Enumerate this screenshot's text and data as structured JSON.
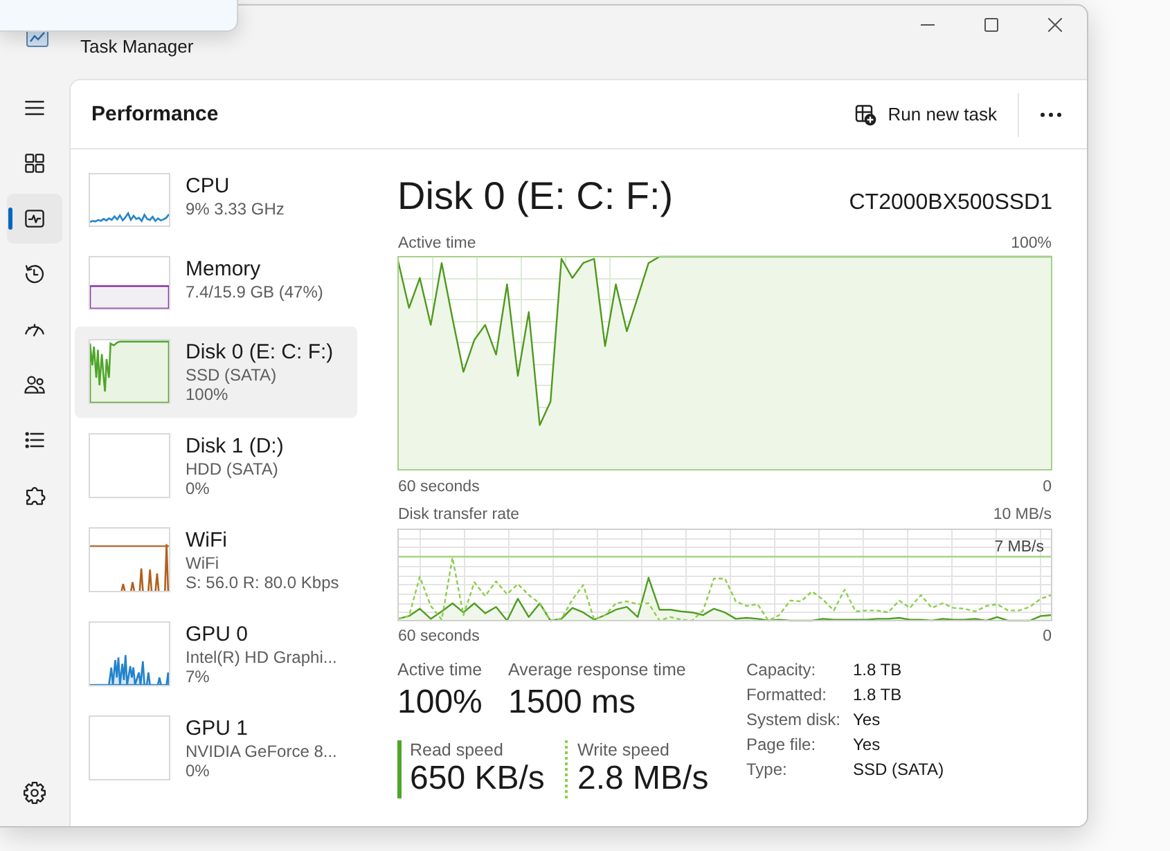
{
  "window": {
    "title": "Task Manager"
  },
  "nav": {
    "items": [
      {
        "kind": "processes",
        "selected": false
      },
      {
        "kind": "performance",
        "selected": true
      },
      {
        "kind": "history",
        "selected": false
      },
      {
        "kind": "startup",
        "selected": false
      },
      {
        "kind": "users",
        "selected": false
      },
      {
        "kind": "details",
        "selected": false
      },
      {
        "kind": "services",
        "selected": false
      }
    ],
    "bottom_items": [
      {
        "kind": "settings",
        "selected": false
      }
    ]
  },
  "header": {
    "title": "Performance",
    "actions": [
      {
        "label": "Run new task"
      }
    ]
  },
  "devices": [
    {
      "name": "CPU",
      "details": [
        "9% 3.33 GHz"
      ],
      "kind": "jagged",
      "color": "#2383cc",
      "selected": false
    },
    {
      "name": "Memory",
      "details": [
        "7.4/15.9 GB (47%)"
      ],
      "kind": "level",
      "color": "#8b32a8",
      "selected": false
    },
    {
      "name": "Disk 0 (E: C: F:)",
      "details": [
        "SSD (SATA)",
        "100%"
      ],
      "kind": "saturated",
      "color": "#4ea52a",
      "selected": true
    },
    {
      "name": "Disk 1 (D:)",
      "details": [
        "HDD (SATA)",
        "0%"
      ],
      "kind": "empty",
      "selected": false
    },
    {
      "name": "WiFi",
      "details": [
        "WiFi",
        "S: 56.0 R: 80.0 Kbps"
      ],
      "kind": "spikes",
      "color": "#b0601e",
      "selected": false
    },
    {
      "name": "GPU 0",
      "details": [
        "Intel(R) HD Graphi...",
        "7%"
      ],
      "kind": "peaks",
      "color": "#2383cc",
      "selected": false
    },
    {
      "name": "GPU 1",
      "details": [
        "NVIDIA GeForce 8...",
        "0%"
      ],
      "kind": "empty",
      "selected": false
    }
  ],
  "detail": {
    "title": "Disk 0 (E: C: F:)",
    "model": "CT2000BX500SSD1",
    "active_time_graph": {
      "title": "Active time",
      "max_label": "100%",
      "span_label": "60 seconds",
      "end_label": "0"
    },
    "transfer_graph": {
      "title": "Disk transfer rate",
      "max_label": "10 MB/s",
      "scale_label": "7 MB/s",
      "span_label": "60 seconds",
      "end_label": "0"
    },
    "stat_rows": [
      [
        {
          "label": "Active time",
          "value": "100%",
          "kind": "plain"
        },
        {
          "label": "Average response time",
          "value": "1500 ms",
          "kind": "plain"
        }
      ],
      [
        {
          "label": "Read speed",
          "value": "650 KB/s",
          "kind": "solid"
        },
        {
          "label": "Write speed",
          "value": "2.8 MB/s",
          "kind": "dotted"
        }
      ]
    ],
    "properties": [
      {
        "label": "Capacity:",
        "value": "1.8 TB"
      },
      {
        "label": "Formatted:",
        "value": "1.8 TB"
      },
      {
        "label": "System disk:",
        "value": "Yes"
      },
      {
        "label": "Page file:",
        "value": "Yes"
      },
      {
        "label": "Type:",
        "value": "SSD (SATA)"
      }
    ]
  }
}
